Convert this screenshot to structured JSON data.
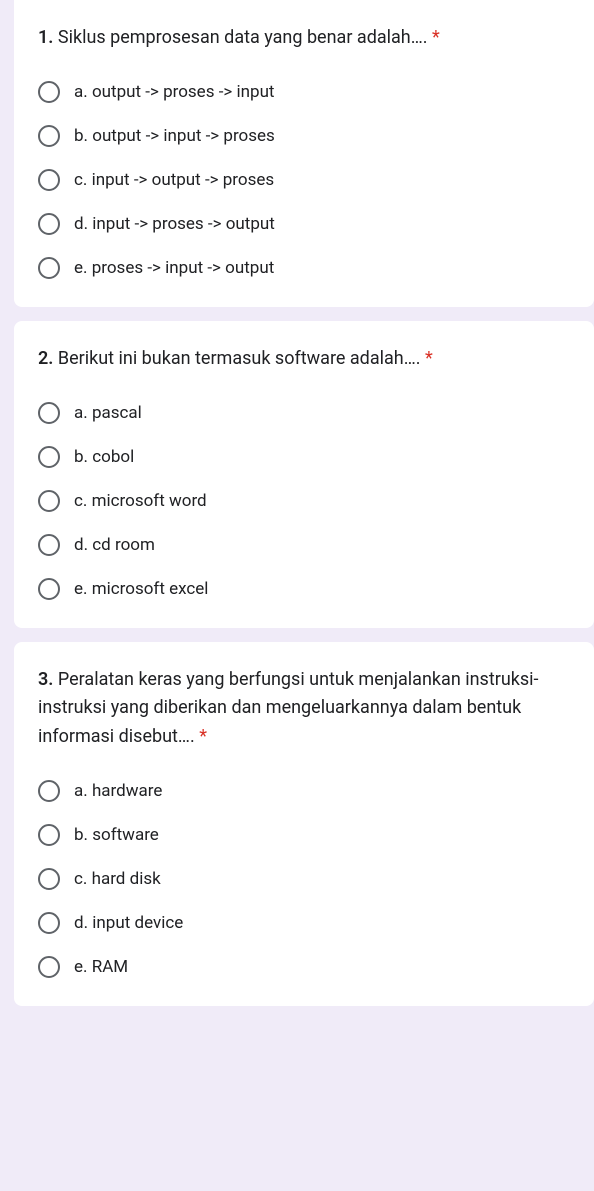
{
  "questions": [
    {
      "number": "1.",
      "text": "Siklus pemprosesan data yang benar adalah….",
      "required": true,
      "options": [
        "a. output -> proses -> input",
        "b. output -> input -> proses",
        "c. input -> output -> proses",
        "d. input -> proses -> output",
        "e. proses -> input -> output"
      ]
    },
    {
      "number": "2.",
      "text": "Berikut ini bukan termasuk software adalah….",
      "required": true,
      "options": [
        "a. pascal",
        "b. cobol",
        "c. microsoft word",
        "d. cd room",
        "e. microsoft excel"
      ]
    },
    {
      "number": "3.",
      "text": "Peralatan keras yang berfungsi untuk menjalankan instruksi-instruksi yang diberikan dan mengeluarkannya dalam bentuk informasi disebut….",
      "required": true,
      "options": [
        "a. hardware",
        "b. software",
        "c. hard disk",
        "d. input device",
        "e. RAM"
      ]
    }
  ],
  "asterisk": "*"
}
